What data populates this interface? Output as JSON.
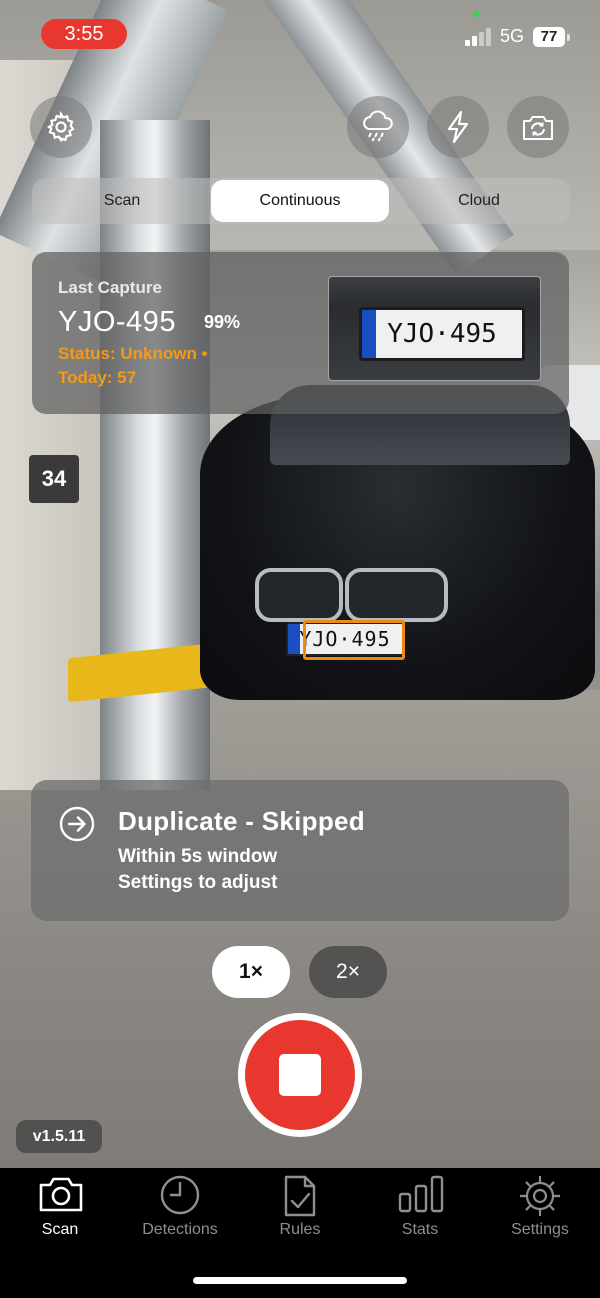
{
  "status_bar": {
    "time": "3:55",
    "network": "5G",
    "battery": "77",
    "colors": {
      "time_pill": "#e8372f",
      "privacy_dot": "#32d74b"
    }
  },
  "top_controls": {
    "settings_icon": "gear-icon",
    "weather_icon": "cloud-rain-icon",
    "flash_icon": "lightning-bolt-icon",
    "camera_icon": "camera-switch-icon"
  },
  "modes": {
    "items": [
      "Scan",
      "Continuous",
      "Cloud"
    ],
    "selected": "Continuous"
  },
  "last_capture": {
    "label": "Last Capture",
    "plate": "YJO-495",
    "confidence": "99%",
    "status": "Status: Unknown •",
    "today": "Today: 57",
    "thumbnail_plate": "YJO·495",
    "status_color": "#f59a17"
  },
  "scene": {
    "parking_spot": "34",
    "plate_on_car": "YJO·495",
    "detection_box_color": "#e88a13"
  },
  "toast": {
    "icon": "arrow-right-circle-icon",
    "title": "Duplicate - Skipped",
    "line1": "Within 5s window",
    "line2": "Settings to adjust"
  },
  "zoom": {
    "options": [
      "1×",
      "2×"
    ],
    "selected": "1×"
  },
  "record": {
    "state": "recording",
    "color": "#e8372f"
  },
  "version": "v1.5.11",
  "tabs": [
    {
      "label": "Scan",
      "icon": "camera-icon",
      "active": true
    },
    {
      "label": "Detections",
      "icon": "clock-icon",
      "active": false
    },
    {
      "label": "Rules",
      "icon": "document-check-icon",
      "active": false
    },
    {
      "label": "Stats",
      "icon": "bar-chart-icon",
      "active": false
    },
    {
      "label": "Settings",
      "icon": "gear-icon",
      "active": false
    }
  ]
}
